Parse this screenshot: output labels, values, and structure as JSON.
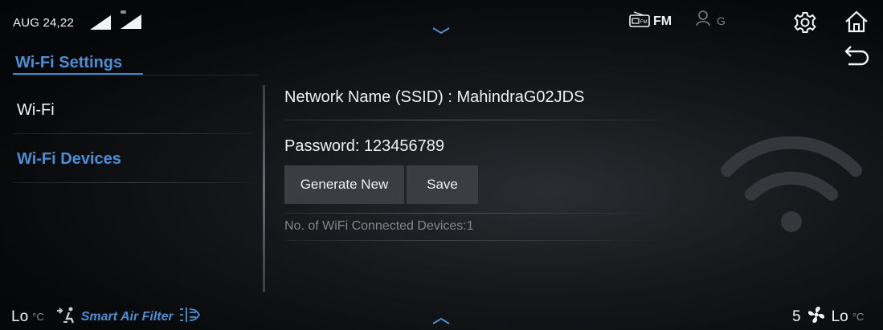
{
  "status_bar": {
    "date": "AUG 24,22",
    "source_label": "FM",
    "user_label": "G"
  },
  "wifi_menu": {
    "title": "Wi-Fi Settings",
    "items": [
      {
        "label": "Wi-Fi",
        "selected": false
      },
      {
        "label": "Wi-Fi Devices",
        "selected": true
      }
    ]
  },
  "wifi_details": {
    "ssid_text": "Network Name (SSID) : MahindraG02JDS",
    "password_text": "Password: 123456789",
    "generate_label": "Generate New",
    "save_label": "Save",
    "connected_text": "No. of WiFi Connected Devices:1"
  },
  "climate": {
    "left_temp": "Lo",
    "left_unit": "°C",
    "air_filter_label": "Smart Air Filter",
    "fan_speed": "5",
    "right_temp": "Lo",
    "right_unit": "°C"
  },
  "colors": {
    "accent": "#4a8fd6",
    "button_bg": "#3a3d41",
    "background": "#050607"
  },
  "icons": [
    "signal-icon",
    "car-signal-icon",
    "chevron-down-icon",
    "radio-icon",
    "user-icon",
    "gear-icon",
    "home-icon",
    "back-icon",
    "wifi-icon",
    "seat-airflow-icon",
    "air-filter-icon",
    "fan-icon",
    "chevron-up-icon"
  ]
}
